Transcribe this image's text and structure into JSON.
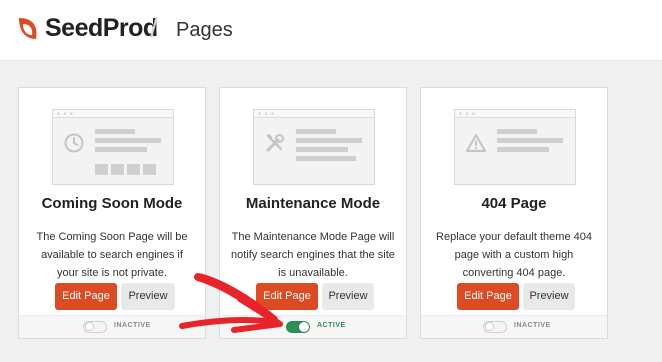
{
  "header": {
    "brand": "SeedProd",
    "separator": "/",
    "title": "Pages"
  },
  "colors": {
    "accent": "#dd4b25",
    "active": "#2a8f57",
    "annotation_arrow": "#e8232a"
  },
  "cards": [
    {
      "title": "Coming Soon Mode",
      "description": "The Coming Soon Page will be available to search engines if your site is not private.",
      "edit_label": "Edit Page",
      "preview_label": "Preview",
      "status": "INACTIVE",
      "active": false,
      "thumb_icon": "clock-icon"
    },
    {
      "title": "Maintenance Mode",
      "description": "The Maintenance Mode Page will notify search engines that the site is unavailable.",
      "edit_label": "Edit Page",
      "preview_label": "Preview",
      "status": "ACTIVE",
      "active": true,
      "thumb_icon": "tools-icon"
    },
    {
      "title": "404 Page",
      "description": "Replace your default theme 404 page with a custom high converting 404 page.",
      "edit_label": "Edit Page",
      "preview_label": "Preview",
      "status": "INACTIVE",
      "active": false,
      "thumb_icon": "warning-icon"
    }
  ]
}
